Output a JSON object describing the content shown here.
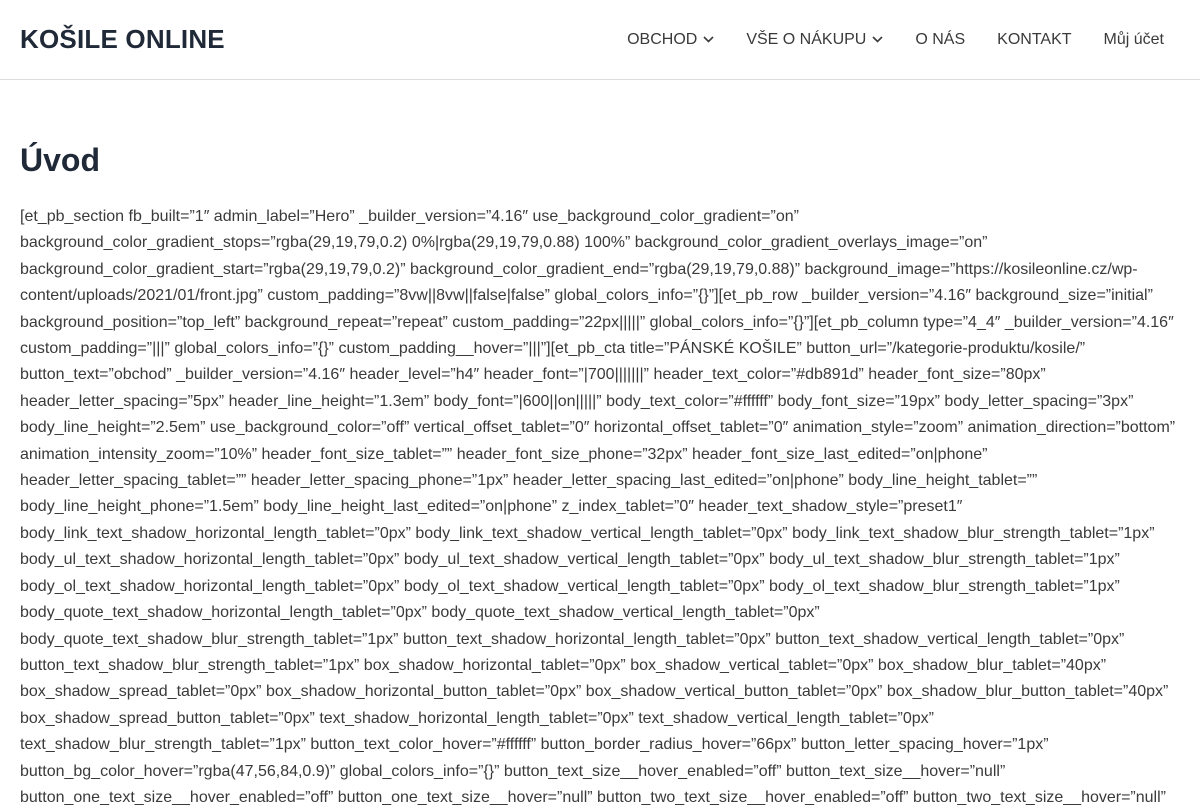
{
  "header": {
    "site_title": "KOŠILE ONLINE",
    "nav": [
      {
        "label": "OBCHOD",
        "has_dropdown": true,
        "icon": "chevron-down-icon"
      },
      {
        "label": "VŠE O NÁKUPU",
        "has_dropdown": true,
        "icon": "chevron-down-icon"
      },
      {
        "label": "O NÁS",
        "has_dropdown": false
      },
      {
        "label": "KONTAKT",
        "has_dropdown": false
      },
      {
        "label": "Můj účet",
        "has_dropdown": false
      }
    ]
  },
  "main": {
    "page_title": "Úvod",
    "body_text": "[et_pb_section fb_built=”1″ admin_label=”Hero” _builder_version=”4.16″ use_background_color_gradient=”on” background_color_gradient_stops=”rgba(29,19,79,0.2) 0%|rgba(29,19,79,0.88) 100%” background_color_gradient_overlays_image=”on” background_color_gradient_start=”rgba(29,19,79,0.2)” background_color_gradient_end=”rgba(29,19,79,0.88)” background_image=”https://kosileonline.cz/wp-content/uploads/2021/01/front.jpg” custom_padding=”8vw||8vw||false|false” global_colors_info=”{}”][et_pb_row _builder_version=”4.16″ background_size=”initial” background_position=”top_left” background_repeat=”repeat” custom_padding=”22px|||||” global_colors_info=”{}”][et_pb_column type=”4_4″ _builder_version=”4.16″ custom_padding=”|||” global_colors_info=”{}” custom_padding__hover=”|||”][et_pb_cta title=”PÁNSKÉ KOŠILE” button_url=”/kategorie-produktu/kosile/” button_text=”obchod” _builder_version=”4.16″ header_level=”h4″ header_font=”|700|||||||” header_text_color=”#db891d” header_font_size=”80px” header_letter_spacing=”5px” header_line_height=”1.3em” body_font=”|600||on|||||” body_text_color=”#ffffff” body_font_size=”19px” body_letter_spacing=”3px” body_line_height=”2.5em” use_background_color=”off” vertical_offset_tablet=”0″ horizontal_offset_tablet=”0″ animation_style=”zoom” animation_direction=”bottom” animation_intensity_zoom=”10%” header_font_size_tablet=”” header_font_size_phone=”32px” header_font_size_last_edited=”on|phone” header_letter_spacing_tablet=”” header_letter_spacing_phone=”1px” header_letter_spacing_last_edited=”on|phone” body_line_height_tablet=”” body_line_height_phone=”1.5em” body_line_height_last_edited=”on|phone” z_index_tablet=”0″ header_text_shadow_style=”preset1″ body_link_text_shadow_horizontal_length_tablet=”0px” body_link_text_shadow_vertical_length_tablet=”0px” body_link_text_shadow_blur_strength_tablet=”1px” body_ul_text_shadow_horizontal_length_tablet=”0px” body_ul_text_shadow_vertical_length_tablet=”0px” body_ul_text_shadow_blur_strength_tablet=”1px” body_ol_text_shadow_horizontal_length_tablet=”0px” body_ol_text_shadow_vertical_length_tablet=”0px” body_ol_text_shadow_blur_strength_tablet=”1px” body_quote_text_shadow_horizontal_length_tablet=”0px” body_quote_text_shadow_vertical_length_tablet=”0px” body_quote_text_shadow_blur_strength_tablet=”1px” button_text_shadow_horizontal_length_tablet=”0px” button_text_shadow_vertical_length_tablet=”0px” button_text_shadow_blur_strength_tablet=”1px” box_shadow_horizontal_tablet=”0px” box_shadow_vertical_tablet=”0px” box_shadow_blur_tablet=”40px” box_shadow_spread_tablet=”0px” box_shadow_horizontal_button_tablet=”0px” box_shadow_vertical_button_tablet=”0px” box_shadow_blur_button_tablet=”40px” box_shadow_spread_button_tablet=”0px” text_shadow_horizontal_length_tablet=”0px” text_shadow_vertical_length_tablet=”0px” text_shadow_blur_strength_tablet=”1px” button_text_color_hover=”#ffffff” button_border_radius_hover=”66px” button_letter_spacing_hover=”1px” button_bg_color_hover=”rgba(47,56,84,0.9)” global_colors_info=”{}” button_text_size__hover_enabled=”off” button_text_size__hover=”null” button_one_text_size__hover_enabled=”off” button_one_text_size__hover=”null” button_two_text_size__hover_enabled=”off” button_two_text_size__hover=”null”"
  },
  "colors": {
    "heading": "#1f2937",
    "text": "#3a3a3a",
    "border": "#dddddd",
    "background": "#ffffff"
  }
}
